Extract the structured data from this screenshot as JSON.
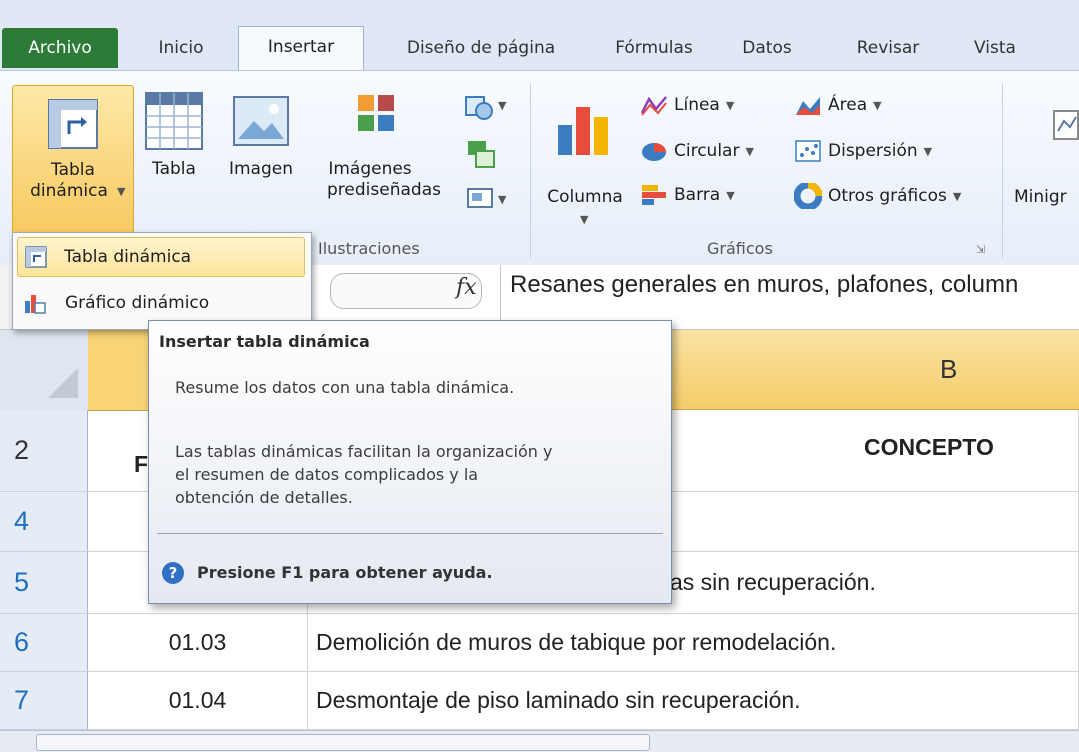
{
  "tabs": [
    "Archivo",
    "Inicio",
    "Insertar",
    "Diseño de página",
    "Fórmulas",
    "Datos",
    "Revisar",
    "Vista"
  ],
  "active_tab": "Insertar",
  "ribbon": {
    "pivot_button": {
      "line1": "Tabla",
      "line2": "dinámica"
    },
    "table_button": "Tabla",
    "image_button": "Imagen",
    "clipart_button": {
      "line1": "Imágenes",
      "line2": "prediseñadas"
    },
    "group_illustrations": "Ilustraciones",
    "column_button": "Columna",
    "line_button": "Línea",
    "area_button": "Área",
    "pie_button": "Circular",
    "scatter_button": "Dispersión",
    "bar_button": "Barra",
    "other_charts_button": "Otros gráficos",
    "group_charts": "Gráficos",
    "sparklines_button": "Minigr"
  },
  "dropdown": {
    "items": [
      "Tabla dinámica",
      "Gráfico dinámico"
    ]
  },
  "formula_bar": {
    "fx": "fx",
    "content": "Resanes generales en  muros, plafones, column"
  },
  "grid": {
    "column_b_header": "B",
    "row_labels": [
      "2",
      "4",
      "5",
      "6",
      "7"
    ],
    "row2_a_partial": "F",
    "concept_header": "CONCEPTO",
    "row5_b_partial": "as sin recuperación.",
    "rows": [
      {
        "code": "01.03",
        "concept": "Demolición de muros de tabique por remodelación."
      },
      {
        "code": "01.04",
        "concept": "Desmontaje de piso laminado sin recuperación."
      }
    ]
  },
  "tooltip": {
    "title": "Insertar tabla dinámica",
    "line1": "Resume los datos con una tabla dinámica.",
    "para2_l1": "Las tablas dinámicas facilitan la organización y",
    "para2_l2": "el resumen de datos complicados y la",
    "para2_l3": "obtención de detalles.",
    "help": "Presione F1 para obtener ayuda."
  },
  "colors": {
    "file_tab": "#2e7b38",
    "highlight": "#f7c65a",
    "row_number": "#1f6fbf"
  }
}
